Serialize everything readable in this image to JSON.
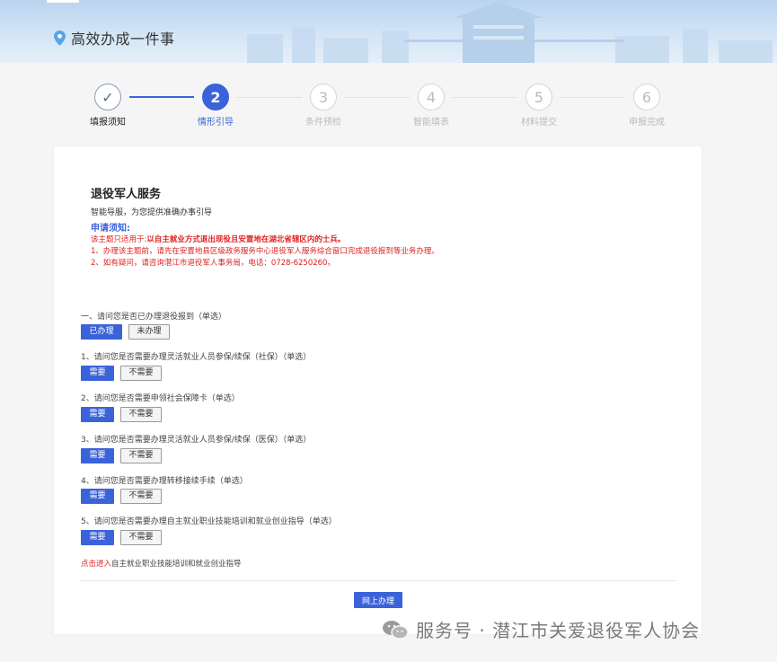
{
  "header": {
    "title": "高效办成一件事"
  },
  "steps": [
    {
      "num": "✓",
      "label": "填报须知"
    },
    {
      "num": "2",
      "label": "情形引导"
    },
    {
      "num": "3",
      "label": "条件预检"
    },
    {
      "num": "4",
      "label": "智能填表"
    },
    {
      "num": "5",
      "label": "材料提交"
    },
    {
      "num": "6",
      "label": "申报完成"
    }
  ],
  "service": {
    "title": "退役军人服务",
    "subtitle": "智能导服，为您提供准确办事引导",
    "notice_heading": "申请须知:",
    "notice_line1_prefix": "该主题只适用于:",
    "notice_line1_bold": "以自主就业方式退出现役且安置地在湖北省辖区内的士兵。",
    "notice_line2": "1、办理该主题前，请先在安置地县区级政务服务中心退役军人服务综合窗口完成退役报到等业务办理。",
    "notice_line3": "2、如有疑问，请咨询潜江市退役军人事务局，电话：0728-6250260。"
  },
  "questions": [
    {
      "text": "一、请问您是否已办理退役报到（单选）",
      "options": [
        "已办理",
        "未办理"
      ]
    },
    {
      "text": "1、请问您是否需要办理灵活就业人员参保/续保（社保）（单选）",
      "options": [
        "需要",
        "不需要"
      ]
    },
    {
      "text": "2、请问您是否需要申领社会保障卡（单选）",
      "options": [
        "需要",
        "不需要"
      ]
    },
    {
      "text": "3、请问您是否需要办理灵活就业人员参保/续保（医保）（单选）",
      "options": [
        "需要",
        "不需要"
      ]
    },
    {
      "text": "4、请问您是否需要办理转移接续手续（单选）",
      "options": [
        "需要",
        "不需要"
      ]
    },
    {
      "text": "5、请问您是否需要办理自主就业职业技能培训和就业创业指导（单选）",
      "options": [
        "需要",
        "不需要"
      ]
    }
  ],
  "footer_link": {
    "link_text": "点击进入",
    "rest_text": "自主就业职业技能培训和就业创业指导"
  },
  "submit_label": "网上办理",
  "watermark": "服务号 · 潜江市关爱退役军人协会",
  "colors": {
    "accent": "#3b63d9",
    "warning": "#e02020"
  }
}
